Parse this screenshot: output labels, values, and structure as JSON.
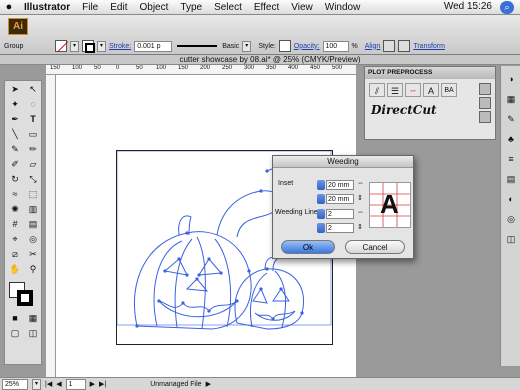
{
  "menubar": {
    "app": "Illustrator",
    "items": [
      "File",
      "Edit",
      "Object",
      "Type",
      "Select",
      "Effect",
      "View",
      "Window"
    ],
    "clock": "Wed 15:26"
  },
  "control": {
    "selection": "Group",
    "stroke_label": "Stroke:",
    "stroke_value": "0.001 p",
    "brush": "Basic",
    "style_label": "Style:",
    "opacity_label": "Opacity:",
    "opacity_value": "100",
    "percent": "%",
    "align": "Align",
    "transform": "Transform"
  },
  "document": {
    "title": "cutter showcase by 08.ai* @ 25% (CMYK/Preview)"
  },
  "ruler": {
    "ticks": [
      "150",
      "100",
      "50",
      "0",
      "50",
      "100",
      "150",
      "200",
      "250",
      "300",
      "350",
      "400",
      "450",
      "500"
    ]
  },
  "plot_panel": {
    "title": "PLOT PREPROCESS",
    "brand": "DirectCut"
  },
  "dialog": {
    "title": "Weeding",
    "inset_label": "Inset",
    "inset_1": "20 mm",
    "inset_2": "20 mm",
    "weeding_label": "Weeding Line",
    "wl_1": "2",
    "wl_2": "2",
    "ok": "Ok",
    "cancel": "Cancel",
    "preview_letter": "A"
  },
  "status": {
    "zoom": "25%",
    "page": "1",
    "state": "Unmanaged File"
  },
  "colors": {
    "selection": "#3b62e0",
    "accent": "#3a78df"
  }
}
